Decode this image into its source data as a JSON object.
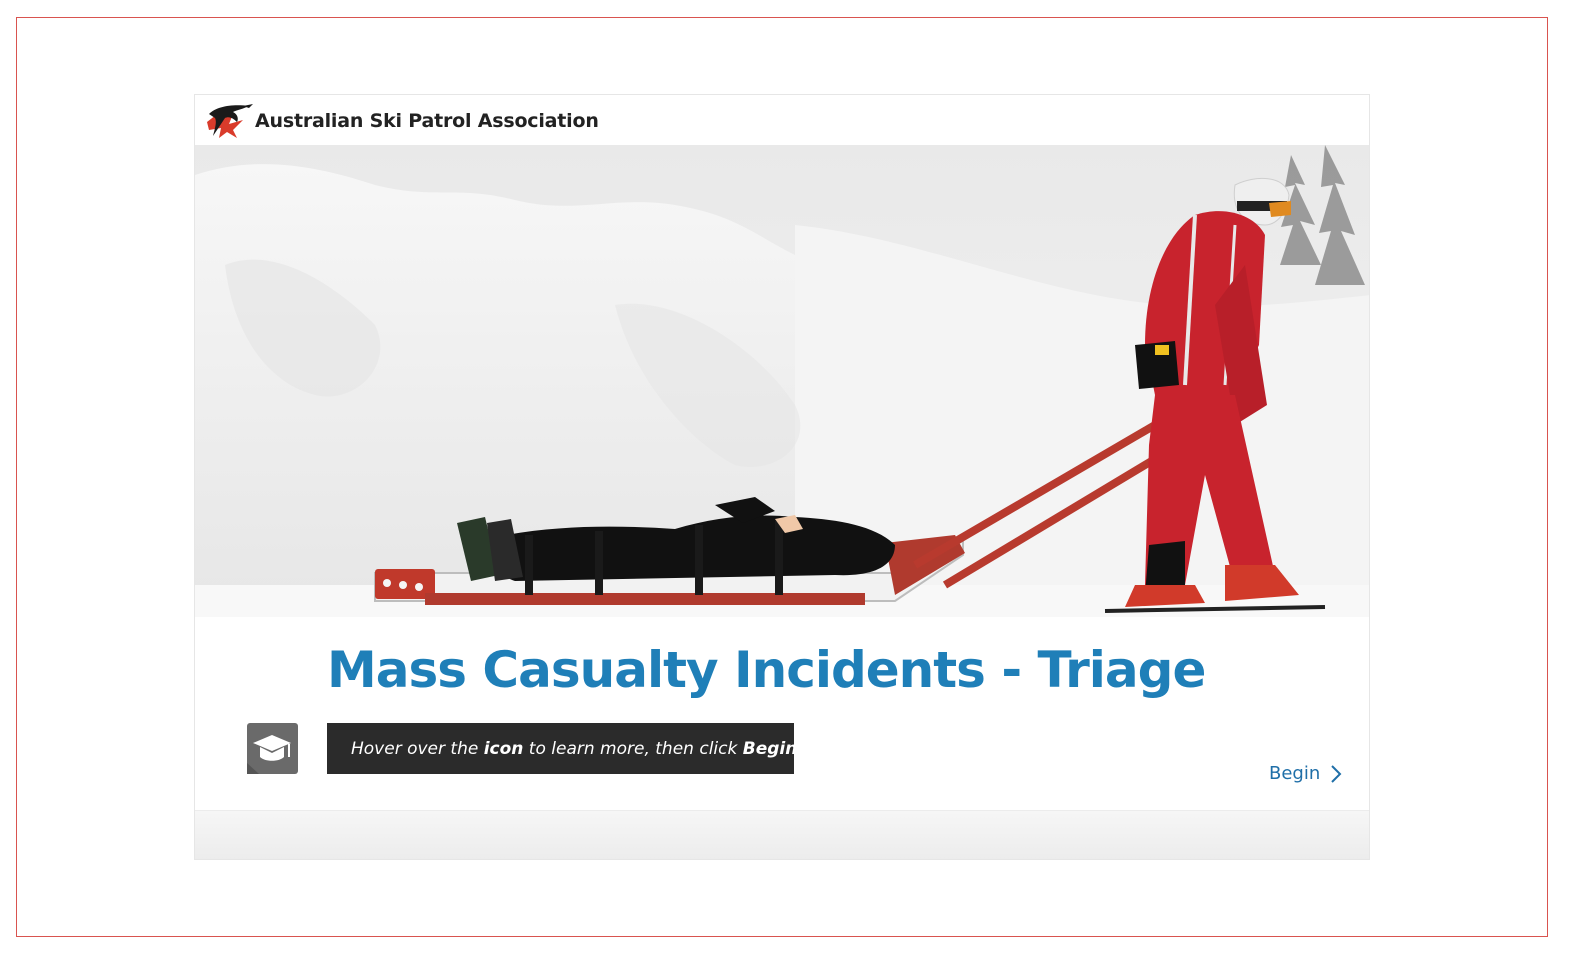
{
  "header": {
    "org_name": "Australian Ski Patrol Association",
    "logo_icon": "aspa-kangaroo-logo"
  },
  "course": {
    "title": "Mass Casualty Incidents - Triage"
  },
  "hint": {
    "icon": "lightbulb-icon",
    "text_part1": "Hover over the ",
    "text_bold1": "icon",
    "text_part2": " to learn more, then click ",
    "text_bold2": "Begin",
    "text_part3": "."
  },
  "info_button": {
    "icon": "graduation-cap-icon"
  },
  "navigation": {
    "begin_label": "Begin",
    "begin_icon": "chevron-right-icon"
  },
  "colors": {
    "title_blue": "#1f7fb8",
    "link_blue": "#1f6fa8",
    "hint_bg": "#2b2b2b",
    "icon_button_bg": "#6a6a6a",
    "frame_red": "#d9534f"
  }
}
